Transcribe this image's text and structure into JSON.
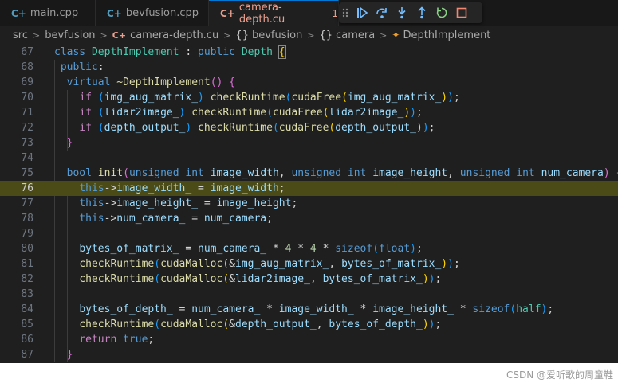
{
  "tabs": [
    {
      "label": "main.cpp",
      "icon": "cpp-file-icon"
    },
    {
      "label": "bevfusion.cpp",
      "icon": "cpp-file-icon"
    },
    {
      "label": "camera-depth.cu",
      "icon": "cuda-file-icon",
      "problems": "1",
      "active": true
    }
  ],
  "debug_toolbar": [
    "drag-grip",
    "continue",
    "step-over",
    "step-into",
    "step-out",
    "restart",
    "stop"
  ],
  "breadcrumb": {
    "items": [
      "src",
      "bevfusion",
      "camera-depth.cu",
      "bevfusion",
      "camera",
      "DepthImplement"
    ],
    "symbol_glyph": "{}"
  },
  "editor": {
    "current_line": 76,
    "line_numbers": [
      "67",
      "68",
      "69",
      "70",
      "71",
      "72",
      "73",
      "74",
      "75",
      "76",
      "77",
      "78",
      "79",
      "80",
      "81",
      "82",
      "83",
      "84",
      "85",
      "86",
      "87"
    ]
  },
  "watermark": "CSDN @爱听歌的周童鞋",
  "colors": {
    "editor_bg": "#1f1f1f",
    "current_line_bg": "#4b4b18",
    "keyword": "#569cd6",
    "function": "#dcdcaa",
    "type": "#4ec9b0",
    "variable": "#9cdcfe",
    "number": "#b5cea8"
  }
}
